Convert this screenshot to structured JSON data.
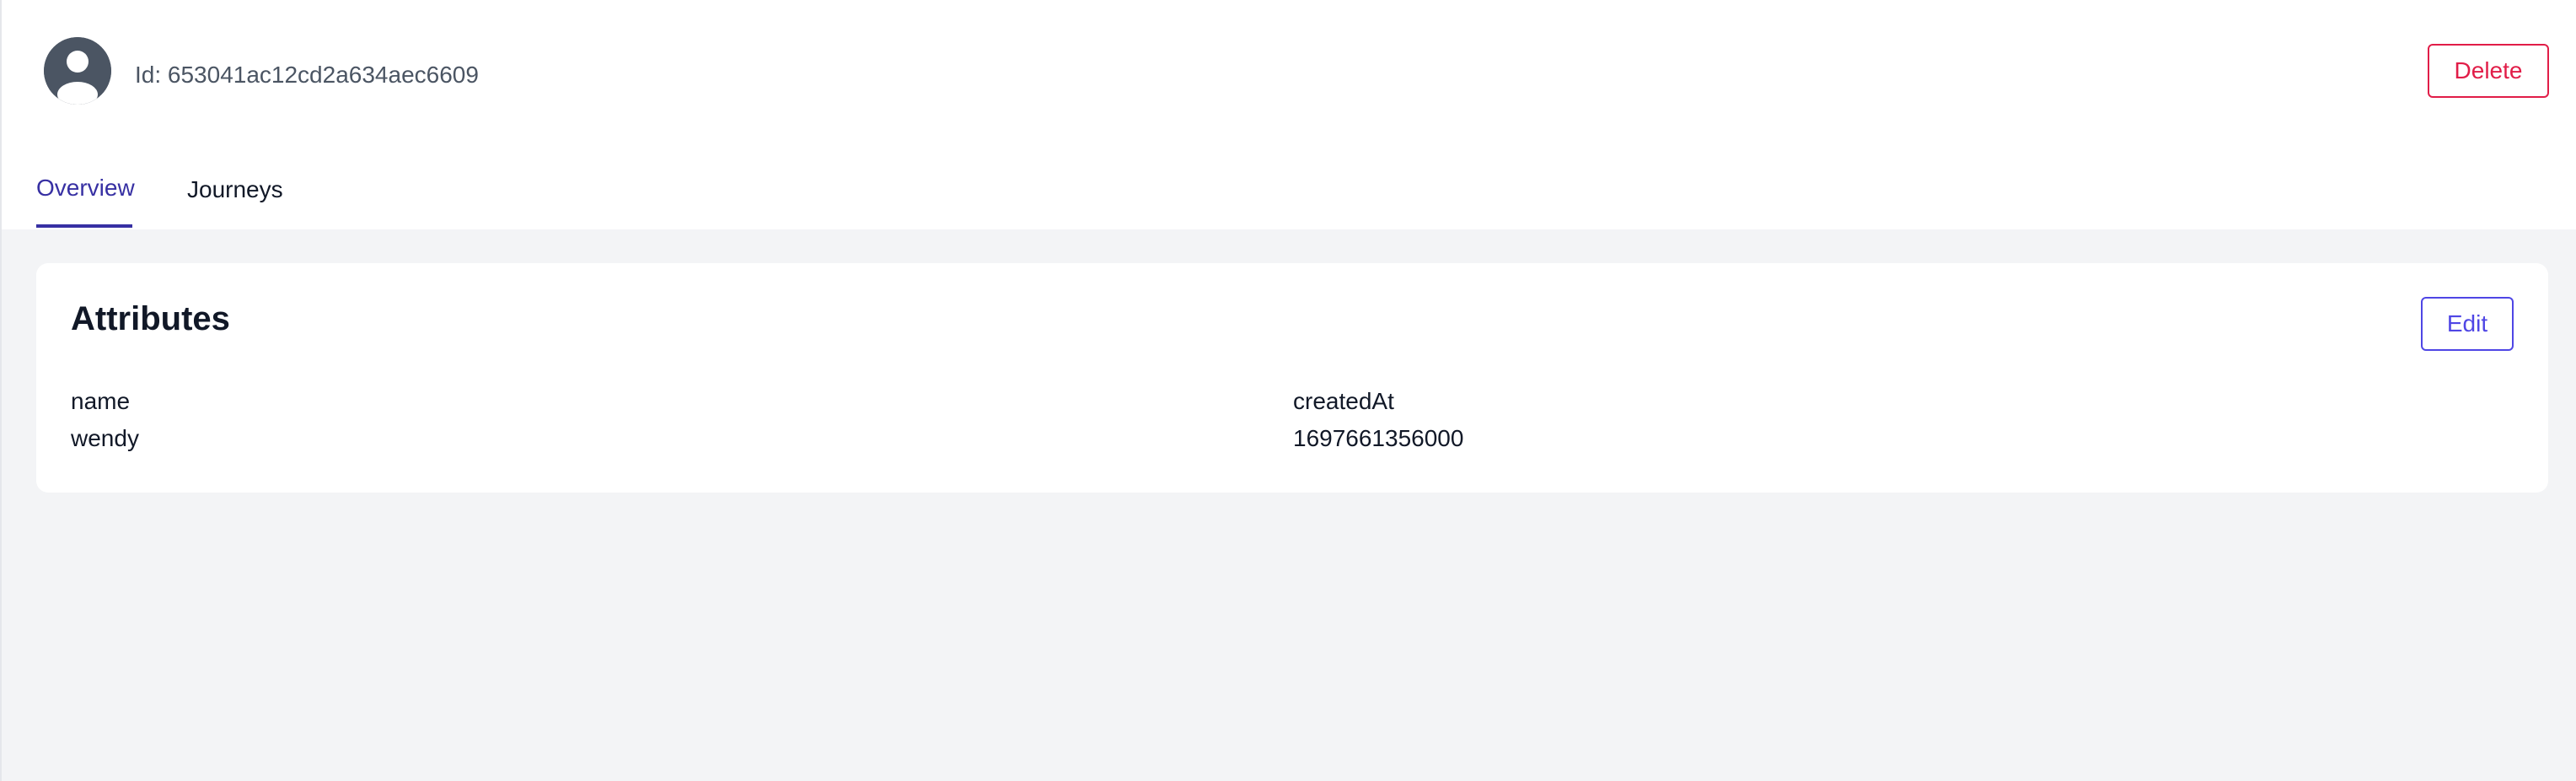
{
  "header": {
    "avatar_icon": "user-circle-icon",
    "id_text": "Id: 653041ac12cd2a634aec6609",
    "delete_label": "Delete"
  },
  "tabs": [
    {
      "label": "Overview",
      "active": true
    },
    {
      "label": "Journeys",
      "active": false
    }
  ],
  "attributes_card": {
    "title": "Attributes",
    "edit_label": "Edit",
    "items": [
      {
        "key": "name",
        "value": "wendy"
      },
      {
        "key": "createdAt",
        "value": "1697661356000"
      }
    ]
  },
  "colors": {
    "accent": "#4f46e5",
    "active_tab": "#3730a3",
    "danger": "#e11d48",
    "background": "#f3f4f6",
    "avatar": "#4b5563"
  }
}
